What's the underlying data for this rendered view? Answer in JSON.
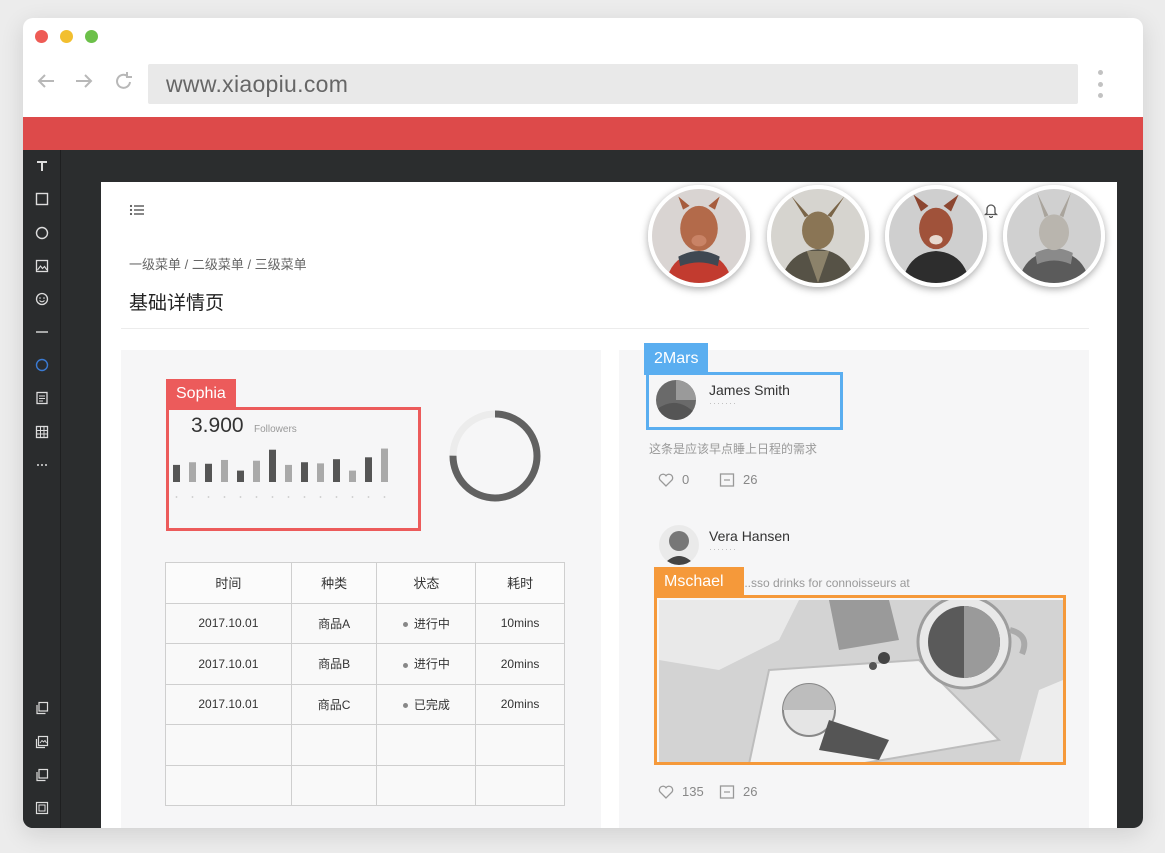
{
  "browser": {
    "url": "www.xiaopiu.com",
    "back_icon": "arrow-left-icon",
    "forward_icon": "arrow-right-icon",
    "reload_icon": "reload-icon",
    "menu_icon": "kebab-menu-icon"
  },
  "colors": {
    "accent_red": "#dd4a4a",
    "tag_red": "#ec5b5b",
    "tag_blue": "#5aaef0",
    "tag_orange": "#f5993a",
    "toolbar_bg": "#2a2c2d"
  },
  "toolbar": {
    "items": [
      "text-tool-icon",
      "rectangle-tool-icon",
      "circle-tool-icon",
      "image-tool-icon",
      "emoji-tool-icon",
      "line-tool-icon",
      "component-tool-icon",
      "document-tool-icon",
      "table-tool-icon",
      "more-tool-icon"
    ],
    "bottom_items": [
      "copy-icon",
      "layers-icon",
      "duplicate-icon",
      "export-icon"
    ]
  },
  "page": {
    "breadcrumb": "一级菜单 / 二级菜单 / 三级菜单",
    "title": "基础详情页"
  },
  "annotations": {
    "left_tag": "Sophia",
    "right_top_tag": "2Mars",
    "right_image_tag": "Mschael"
  },
  "stats": {
    "value": "3.900",
    "label": "Followers",
    "bars": [
      0.45,
      0.52,
      0.48,
      0.58,
      0.3,
      0.56,
      0.85,
      0.45,
      0.52,
      0.49,
      0.6,
      0.3,
      0.65,
      0.88
    ]
  },
  "donut": {
    "progress": 0.75
  },
  "table": {
    "headers": [
      "时间",
      "种类",
      "状态",
      "耗时"
    ],
    "rows": [
      [
        "2017.10.01",
        "商品A",
        "进行中",
        "10mins"
      ],
      [
        "2017.10.01",
        "商品B",
        "进行中",
        "20mins"
      ],
      [
        "2017.10.01",
        "商品C",
        "已完成",
        "20mins"
      ],
      [
        "",
        "",
        "",
        ""
      ],
      [
        "",
        "",
        "",
        ""
      ]
    ]
  },
  "posts": [
    {
      "name": "James Smith",
      "text": "这条是应该早点睡上日程的需求",
      "likes": "0",
      "comments": "26"
    },
    {
      "name": "Vera Hansen",
      "text": "...sso drinks for connoisseurs at",
      "likes": "135",
      "comments": "26"
    }
  ]
}
